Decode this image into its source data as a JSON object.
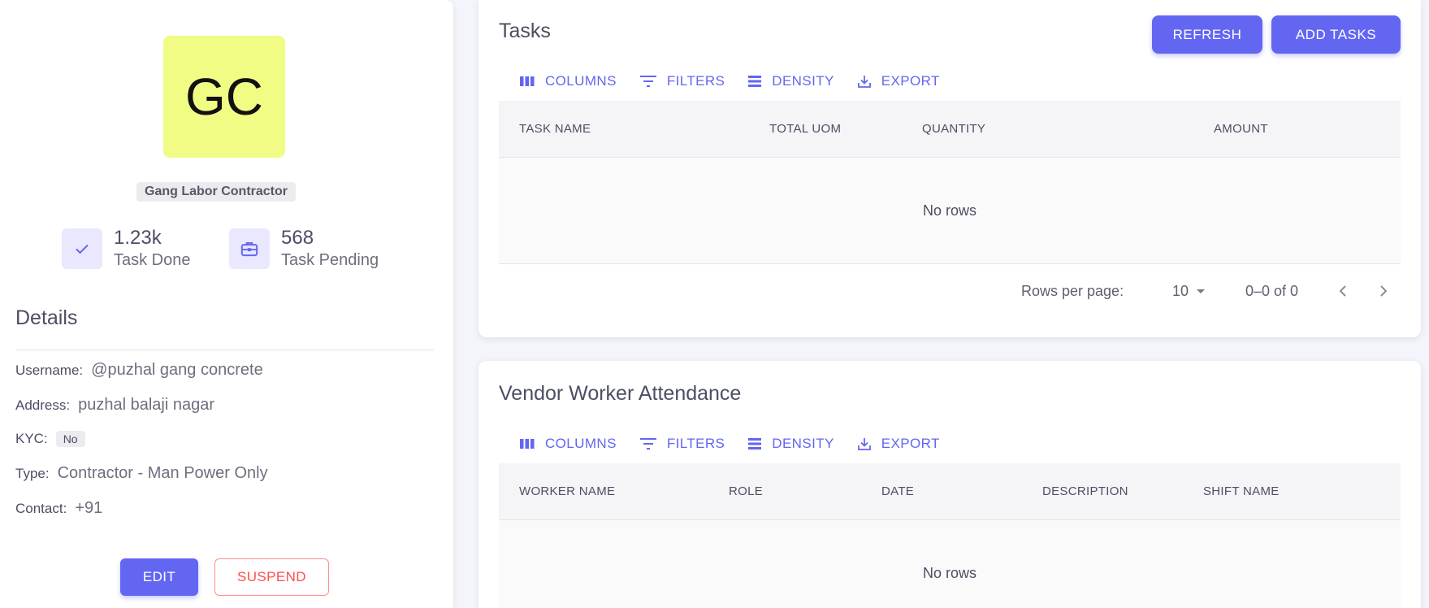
{
  "profile": {
    "initials": "GC",
    "avatar_color": "#f0fc83",
    "role": "Gang Labor Contractor",
    "stats": [
      {
        "value": "1.23k",
        "label": "Task Done",
        "icon": "check-icon"
      },
      {
        "value": "568",
        "label": "Task Pending",
        "icon": "briefcase-icon"
      }
    ],
    "details_title": "Details",
    "details": {
      "username": {
        "key": "Username:",
        "value": "@puzhal gang concrete"
      },
      "address": {
        "key": "Address:",
        "value": "puzhal balaji nagar"
      },
      "kyc": {
        "key": "KYC:",
        "value": "No"
      },
      "type": {
        "key": "Type:",
        "value": "Contractor - Man Power Only"
      },
      "contact": {
        "key": "Contact:",
        "value": "+91"
      }
    },
    "edit_label": "EDIT",
    "suspend_label": "SUSPEND"
  },
  "toolbar": {
    "columns": "COLUMNS",
    "filters": "FILTERS",
    "density": "DENSITY",
    "export": "EXPORT"
  },
  "tasks": {
    "title": "Tasks",
    "refresh_label": "REFRESH",
    "add_label": "ADD TASKS",
    "columns": [
      "TASK NAME",
      "TOTAL UOM",
      "QUANTITY",
      "AMOUNT"
    ],
    "empty_text": "No rows",
    "rows_per_page_label": "Rows per page:",
    "rows_per_page_value": "10",
    "range_text": "0–0 of 0"
  },
  "attendance": {
    "title": "Vendor Worker Attendance",
    "columns": [
      "WORKER NAME",
      "ROLE",
      "DATE",
      "DESCRIPTION",
      "SHIFT NAME"
    ],
    "empty_text": "No rows"
  },
  "colors": {
    "primary": "#6366f1",
    "danger": "#ff4d49"
  }
}
